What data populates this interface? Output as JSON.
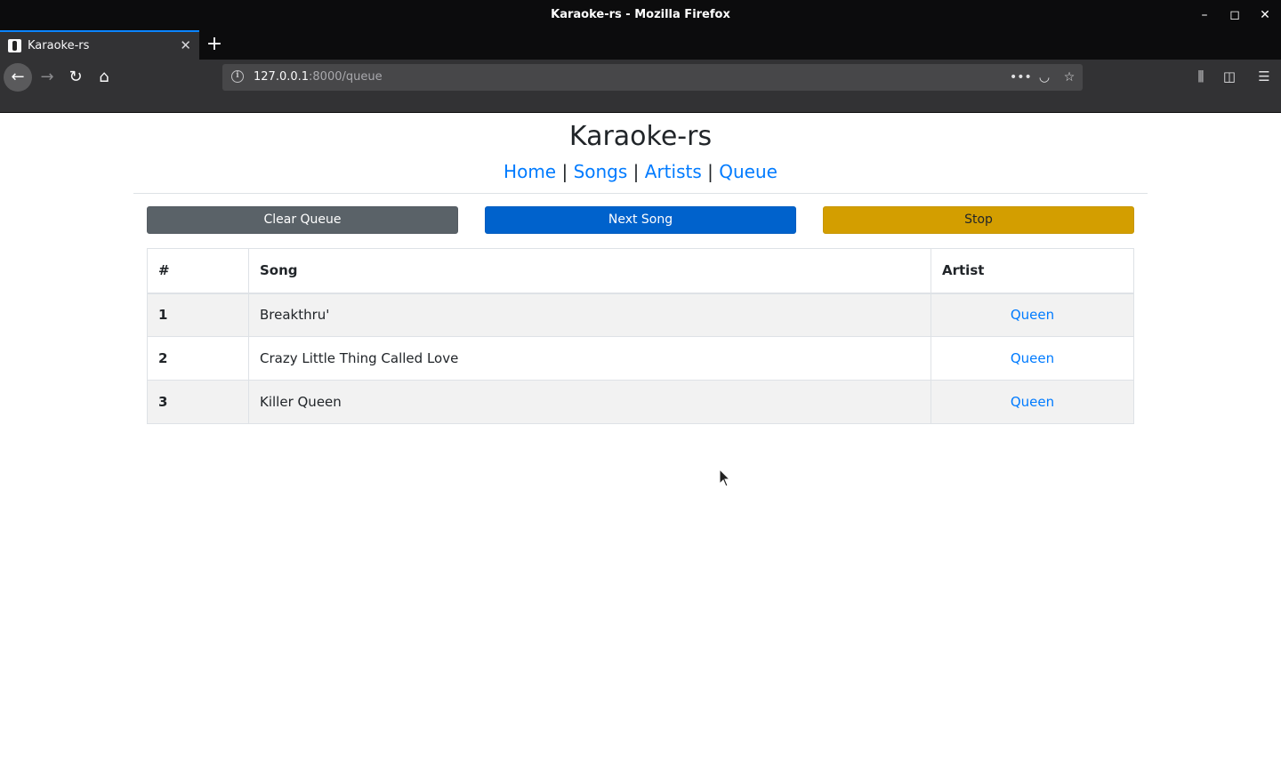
{
  "window": {
    "title": "Karaoke-rs - Mozilla Firefox",
    "minimize_glyph": "–",
    "maximize_glyph": "◻",
    "close_glyph": "✕"
  },
  "tabs": [
    {
      "label": "Karaoke-rs",
      "close_glyph": "✕",
      "active": true
    }
  ],
  "new_tab_glyph": "+",
  "navbar": {
    "back_glyph": "←",
    "forward_glyph": "→",
    "reload_glyph": "↻",
    "home_glyph": "⌂",
    "url_host": "127.0.0.1",
    "url_rest": ":8000/queue",
    "info_glyph": "i",
    "more_glyph": "•••",
    "pocket_glyph": "◡",
    "bookmark_glyph": "☆",
    "library_glyph": "⫼",
    "sidebar_glyph": "◫",
    "menu_glyph": "☰"
  },
  "site": {
    "title": "Karaoke-rs",
    "nav": [
      {
        "label": "Home"
      },
      {
        "label": "Songs"
      },
      {
        "label": "Artists"
      },
      {
        "label": "Queue"
      }
    ],
    "separator": "|"
  },
  "buttons": {
    "clear": "Clear Queue",
    "next": "Next Song",
    "stop": "Stop"
  },
  "table": {
    "headers": {
      "num": "#",
      "song": "Song",
      "artist": "Artist"
    },
    "rows": [
      {
        "num": "1",
        "song": "Breakthru'",
        "artist": "Queen"
      },
      {
        "num": "2",
        "song": "Crazy Little Thing Called Love",
        "artist": "Queen"
      },
      {
        "num": "3",
        "song": "Killer Queen",
        "artist": "Queen"
      }
    ]
  },
  "colors": {
    "link": "#007bff",
    "clear_button": "#5a6268",
    "next_button": "#0062cc",
    "stop_button": "#d39e00",
    "row_stripe": "#f2f2f2"
  }
}
